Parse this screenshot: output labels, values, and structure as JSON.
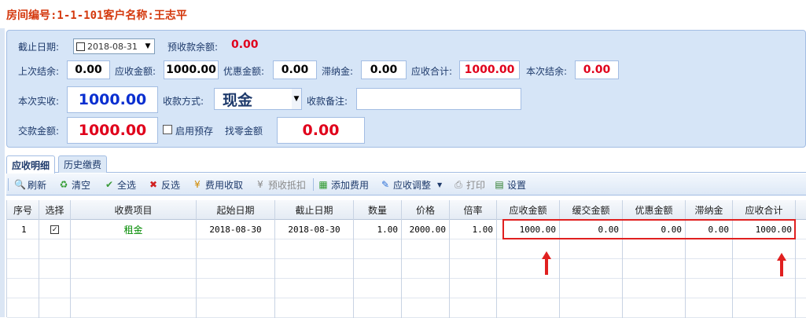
{
  "title": "房间编号:1-1-101客户名称:王志平",
  "form": {
    "cutoff_date_label": "截止日期:",
    "cutoff_date_value": "2018-08-31",
    "prepaid_balance_label": "预收款余额:",
    "prepaid_balance_value": "0.00",
    "last_balance_label": "上次结余:",
    "last_balance_value": "0.00",
    "receivable_label": "应收金额:",
    "receivable_value": "1000.00",
    "discount_label": "优惠金额:",
    "discount_value": "0.00",
    "late_fee_label": "滞纳金:",
    "late_fee_value": "0.00",
    "receivable_total_label": "应收合计:",
    "receivable_total_value": "1000.00",
    "this_balance_label": "本次结余:",
    "this_balance_value": "0.00",
    "actual_received_label": "本次实收:",
    "actual_received_value": "1000.00",
    "payment_method_label": "收款方式:",
    "payment_method_value": "现金",
    "payment_note_label": "收款备注:",
    "payment_note_value": "",
    "paid_amount_label": "交款金额:",
    "paid_amount_value": "1000.00",
    "enable_prepaid_label": "启用预存",
    "change_label": "找零金额",
    "change_value": "0.00"
  },
  "tabs": [
    {
      "label": "应收明细",
      "active": true
    },
    {
      "label": "历史缴费",
      "active": false
    }
  ],
  "toolbar": {
    "refresh": "刷新",
    "clear": "清空",
    "select_all": "全选",
    "invert": "反选",
    "fee_collect": "费用收取",
    "prepaid_offset": "预收抵扣",
    "add_fee": "添加费用",
    "receivable_adjust": "应收调整",
    "print": "打印",
    "settings": "设置"
  },
  "grid": {
    "columns": [
      "序号",
      "选择",
      "收费项目",
      "起始日期",
      "截止日期",
      "数量",
      "价格",
      "倍率",
      "应收金额",
      "缓交金额",
      "优惠金额",
      "滞纳金",
      "应收合计"
    ],
    "rows": [
      {
        "no": "1",
        "selected": true,
        "item": "租金",
        "start": "2018-08-30",
        "end": "2018-08-30",
        "qty": "1.00",
        "price": "2000.00",
        "rate": "1.00",
        "receivable": "1000.00",
        "deferred": "0.00",
        "discount": "0.00",
        "late_fee": "0.00",
        "total": "1000.00"
      }
    ]
  },
  "colors": {
    "title": "#d4380d",
    "panel_bg": "#d6e5f7",
    "value_red": "#e0001b",
    "value_blue": "#0a2fd0",
    "annotation_red": "#e02020"
  }
}
